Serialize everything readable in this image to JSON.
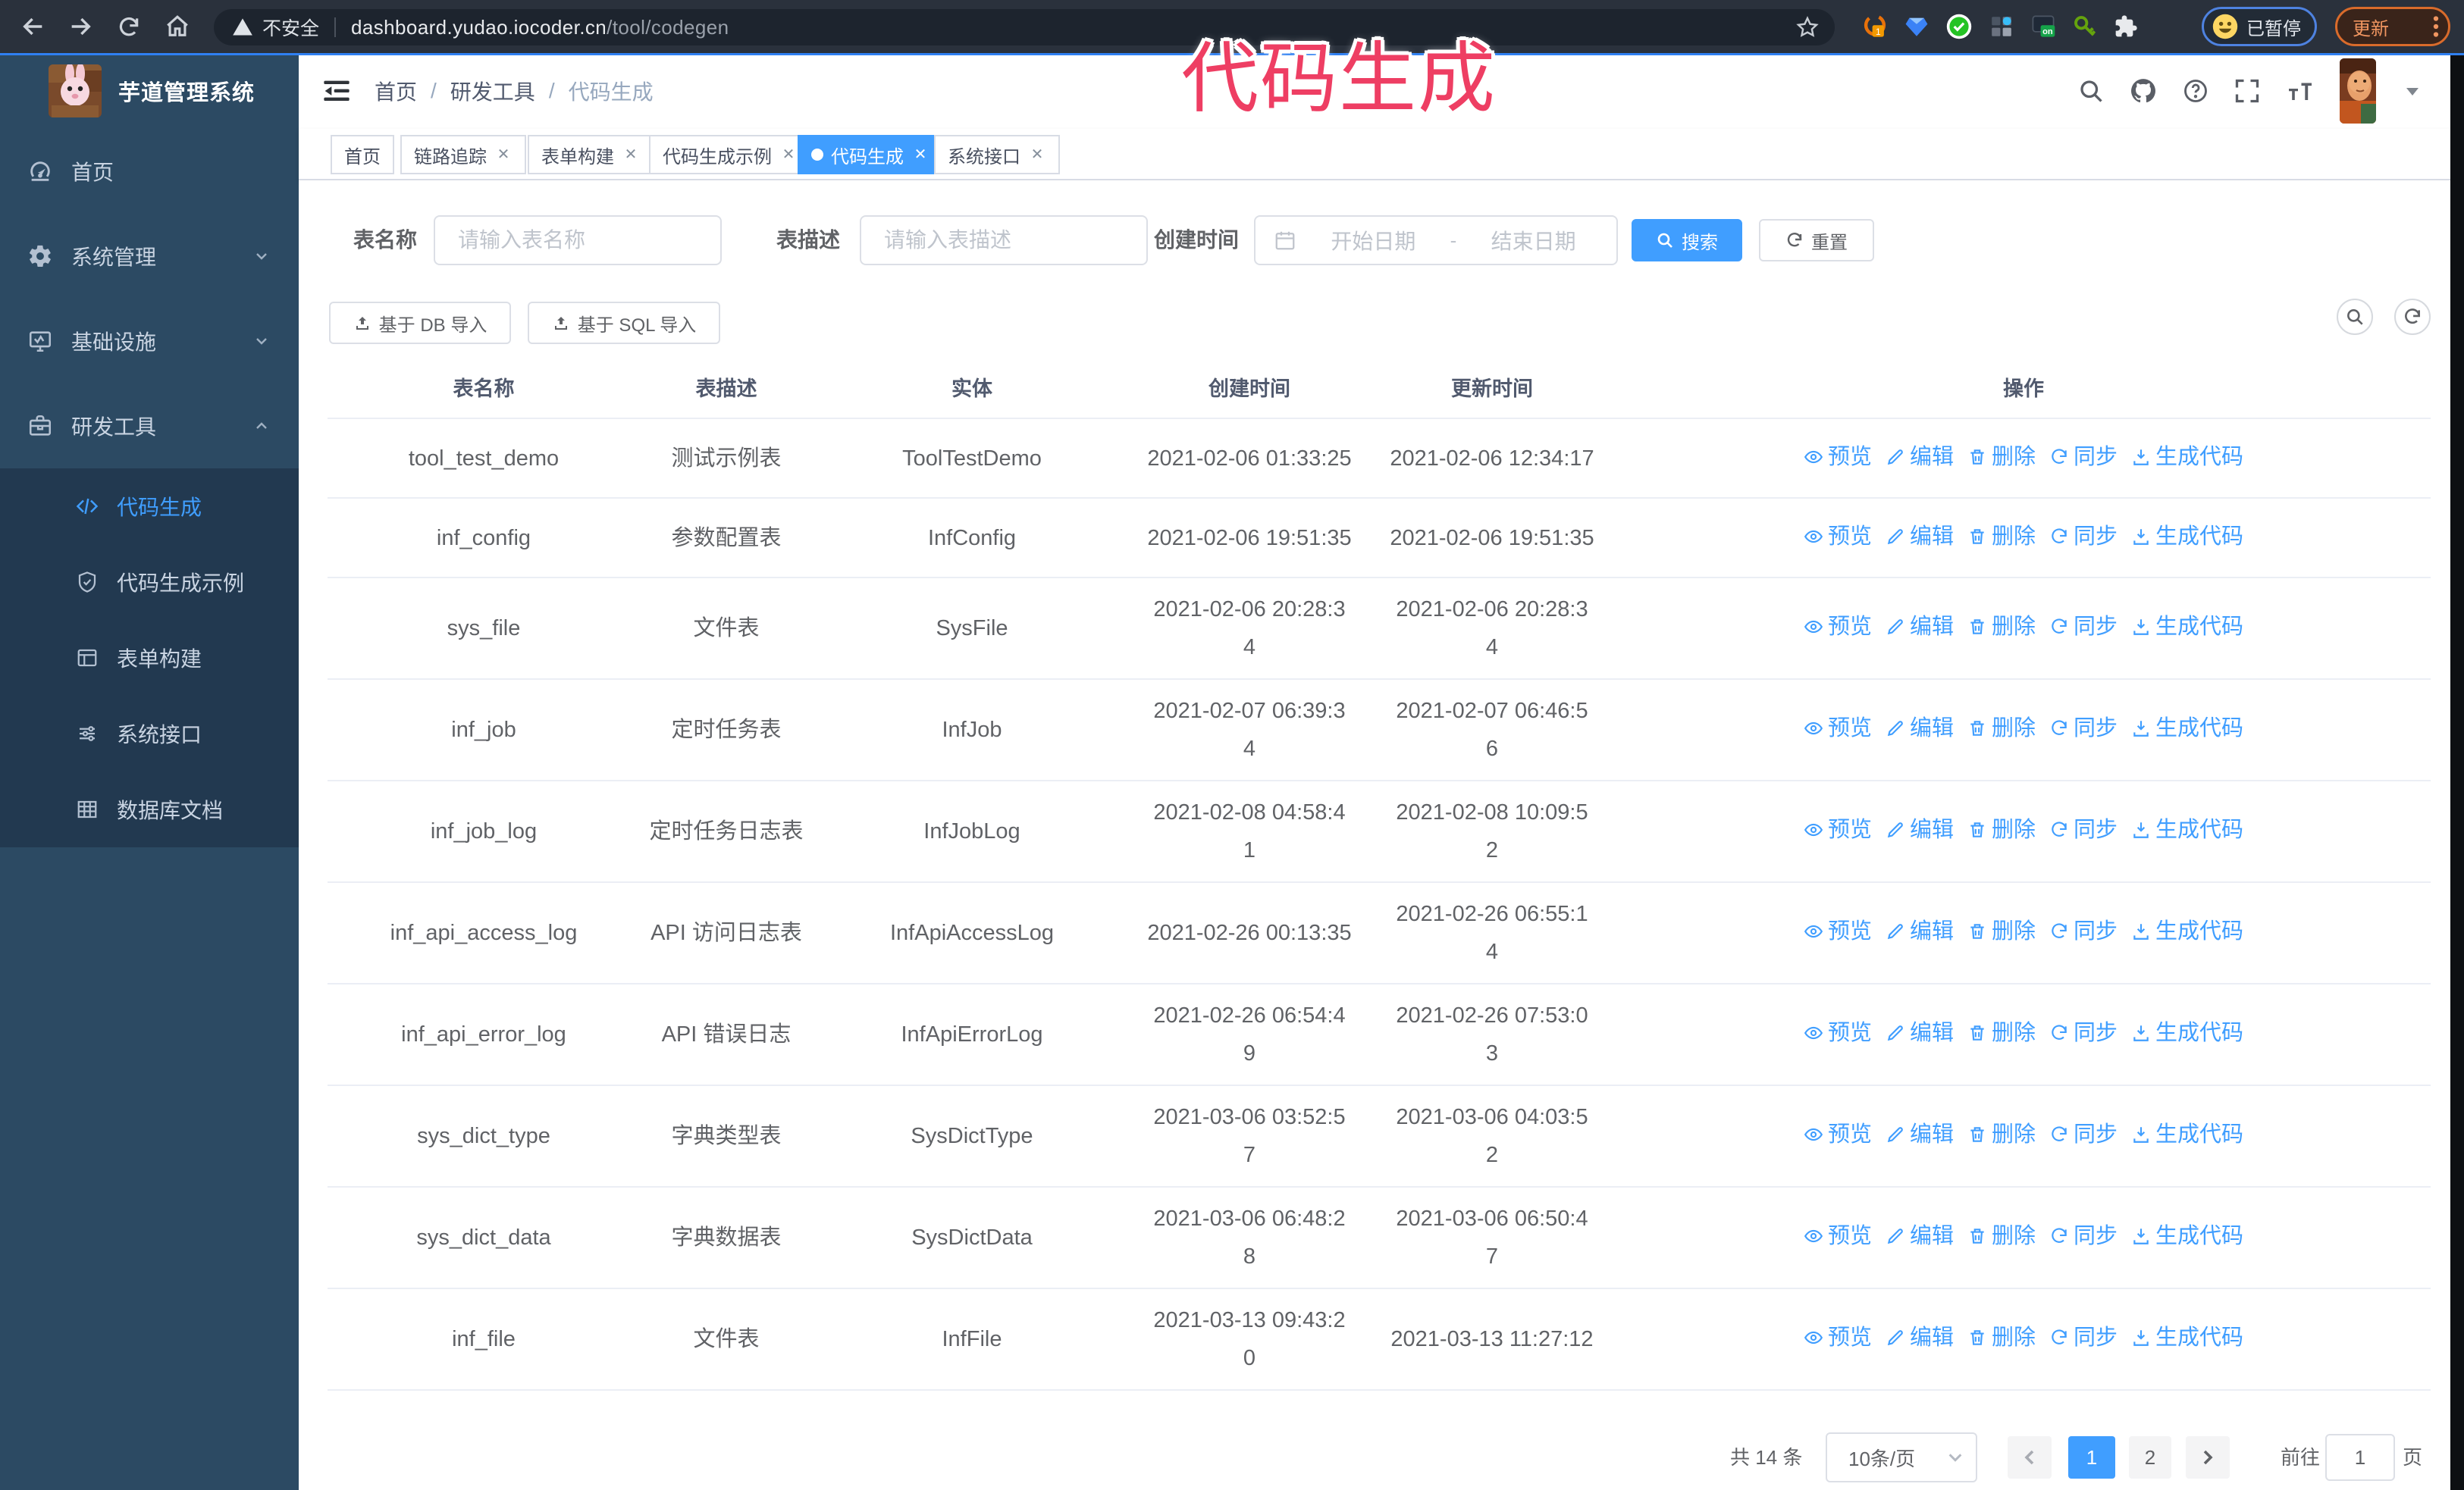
{
  "browser": {
    "security_label": "不安全",
    "url_host": "dashboard.yudao.iocoder.cn",
    "url_path": "/tool/codegen",
    "paused_label": "已暂停",
    "update_label": "更新"
  },
  "annotation": {
    "text": "代码生成",
    "color": "#ee3e63"
  },
  "sidebar": {
    "title": "芋道管理系统",
    "items": [
      {
        "label": "首页",
        "icon": "dashboard-icon"
      },
      {
        "label": "系统管理",
        "icon": "gear-icon"
      },
      {
        "label": "基础设施",
        "icon": "monitor-icon"
      },
      {
        "label": "研发工具",
        "icon": "toolbox-icon"
      }
    ],
    "submenu": [
      {
        "label": "代码生成",
        "icon": "code-icon",
        "active": true
      },
      {
        "label": "代码生成示例",
        "icon": "example-icon"
      },
      {
        "label": "表单构建",
        "icon": "form-icon"
      },
      {
        "label": "系统接口",
        "icon": "api-icon"
      },
      {
        "label": "数据库文档",
        "icon": "database-icon"
      }
    ]
  },
  "navbar": {
    "breadcrumb": [
      "首页",
      "研发工具",
      "代码生成"
    ],
    "separator": "/"
  },
  "tags": [
    {
      "label": "首页",
      "closable": false,
      "active": false
    },
    {
      "label": "链路追踪",
      "closable": true,
      "active": false
    },
    {
      "label": "表单构建",
      "closable": true,
      "active": false
    },
    {
      "label": "代码生成示例",
      "closable": true,
      "active": false
    },
    {
      "label": "代码生成",
      "closable": true,
      "active": true
    },
    {
      "label": "系统接口",
      "closable": true,
      "active": false
    }
  ],
  "filters": {
    "table_name_label": "表名称",
    "table_name_placeholder": "请输入表名称",
    "table_desc_label": "表描述",
    "table_desc_placeholder": "请输入表描述",
    "create_time_label": "创建时间",
    "date_start_placeholder": "开始日期",
    "date_separator": "-",
    "date_end_placeholder": "结束日期",
    "search_label": "搜索",
    "reset_label": "重置"
  },
  "toolbar": {
    "import_db_label": "基于 DB 导入",
    "import_sql_label": "基于 SQL 导入"
  },
  "table": {
    "headers": [
      "表名称",
      "表描述",
      "实体",
      "创建时间",
      "更新时间",
      "操作"
    ],
    "ops": [
      "预览",
      "编辑",
      "删除",
      "同步",
      "生成代码"
    ],
    "rows": [
      {
        "name": "tool_test_demo",
        "desc": "测试示例表",
        "entity": "ToolTestDemo",
        "created": "2021-02-06 01:33:25",
        "updated": "2021-02-06 12:34:17"
      },
      {
        "name": "inf_config",
        "desc": "参数配置表",
        "entity": "InfConfig",
        "created": "2021-02-06 19:51:35",
        "updated": "2021-02-06 19:51:35"
      },
      {
        "name": "sys_file",
        "desc": "文件表",
        "entity": "SysFile",
        "created": "2021-02-06 20:28:3\n4",
        "updated": "2021-02-06 20:28:3\n4"
      },
      {
        "name": "inf_job",
        "desc": "定时任务表",
        "entity": "InfJob",
        "created": "2021-02-07 06:39:3\n4",
        "updated": "2021-02-07 06:46:5\n6"
      },
      {
        "name": "inf_job_log",
        "desc": "定时任务日志表",
        "entity": "InfJobLog",
        "created": "2021-02-08 04:58:4\n1",
        "updated": "2021-02-08 10:09:5\n2"
      },
      {
        "name": "inf_api_access_log",
        "desc": "API 访问日志表",
        "entity": "InfApiAccessLog",
        "created": "2021-02-26 00:13:35",
        "updated": "2021-02-26 06:55:1\n4"
      },
      {
        "name": "inf_api_error_log",
        "desc": "API 错误日志",
        "entity": "InfApiErrorLog",
        "created": "2021-02-26 06:54:4\n9",
        "updated": "2021-02-26 07:53:0\n3"
      },
      {
        "name": "sys_dict_type",
        "desc": "字典类型表",
        "entity": "SysDictType",
        "created": "2021-03-06 03:52:5\n7",
        "updated": "2021-03-06 04:03:5\n2"
      },
      {
        "name": "sys_dict_data",
        "desc": "字典数据表",
        "entity": "SysDictData",
        "created": "2021-03-06 06:48:2\n8",
        "updated": "2021-03-06 06:50:4\n7"
      },
      {
        "name": "inf_file",
        "desc": "文件表",
        "entity": "InfFile",
        "created": "2021-03-13 09:43:2\n0",
        "updated": "2021-03-13 11:27:12"
      }
    ]
  },
  "pagination": {
    "total_label": "共 14 条",
    "page_size_label": "10条/页",
    "pages": [
      "1",
      "2"
    ],
    "active_page": "1",
    "goto_label": "前往",
    "goto_value": "1",
    "page_unit_label": "页"
  },
  "colors": {
    "primary": "#409eff",
    "sidebar_bg": "#2c4a63",
    "submenu_bg": "#223950",
    "annotation_pink": "#ee3e63",
    "active_tag_bg": "#409eff"
  }
}
